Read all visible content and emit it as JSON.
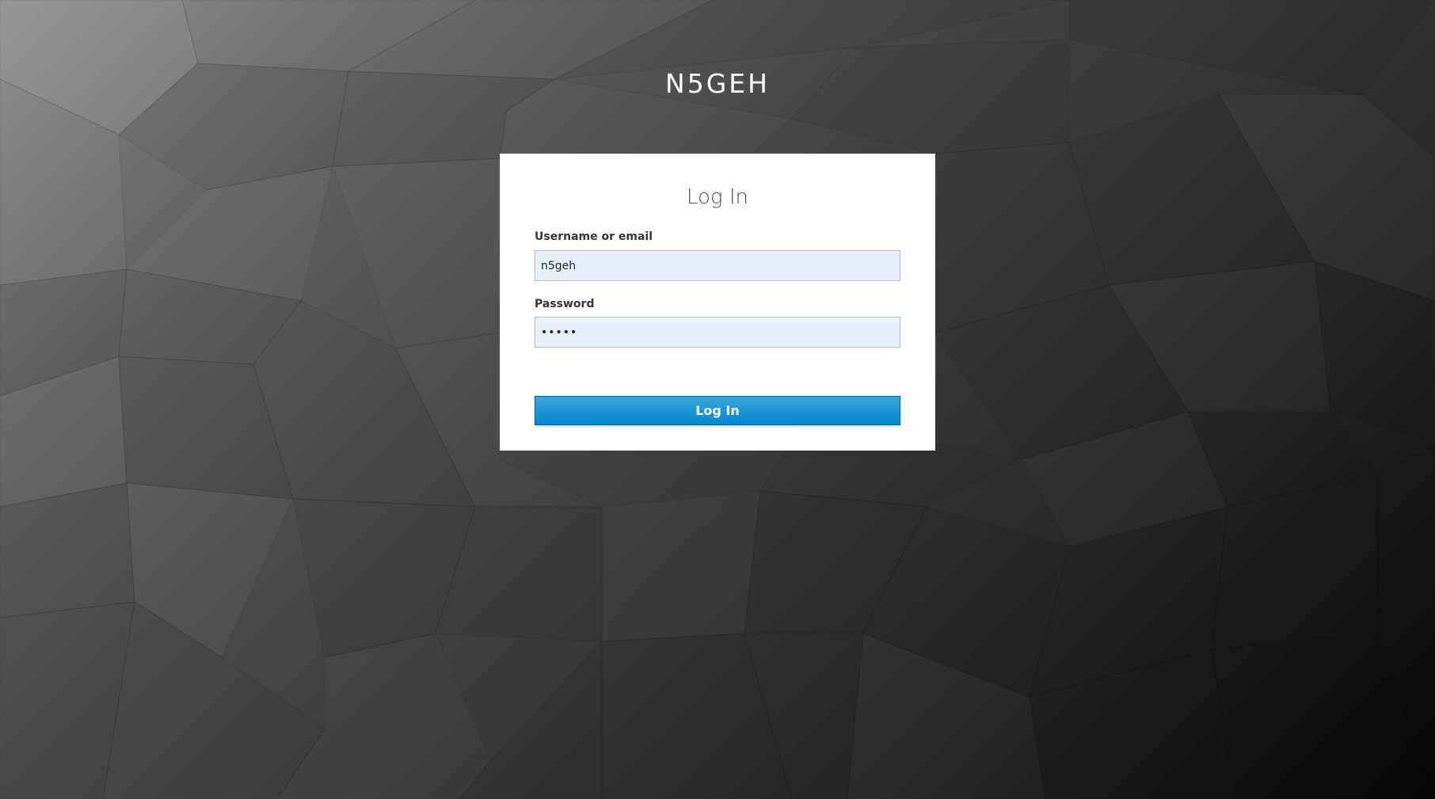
{
  "brand": {
    "title": "N5GEH"
  },
  "login": {
    "heading": "Log In",
    "username_label": "Username or email",
    "username_value": "n5geh",
    "password_label": "Password",
    "password_value": "•••••",
    "submit_label": "Log In"
  },
  "colors": {
    "button_primary": "#0088ce",
    "input_fill": "#e8f0fe",
    "card_background": "#ffffff"
  }
}
